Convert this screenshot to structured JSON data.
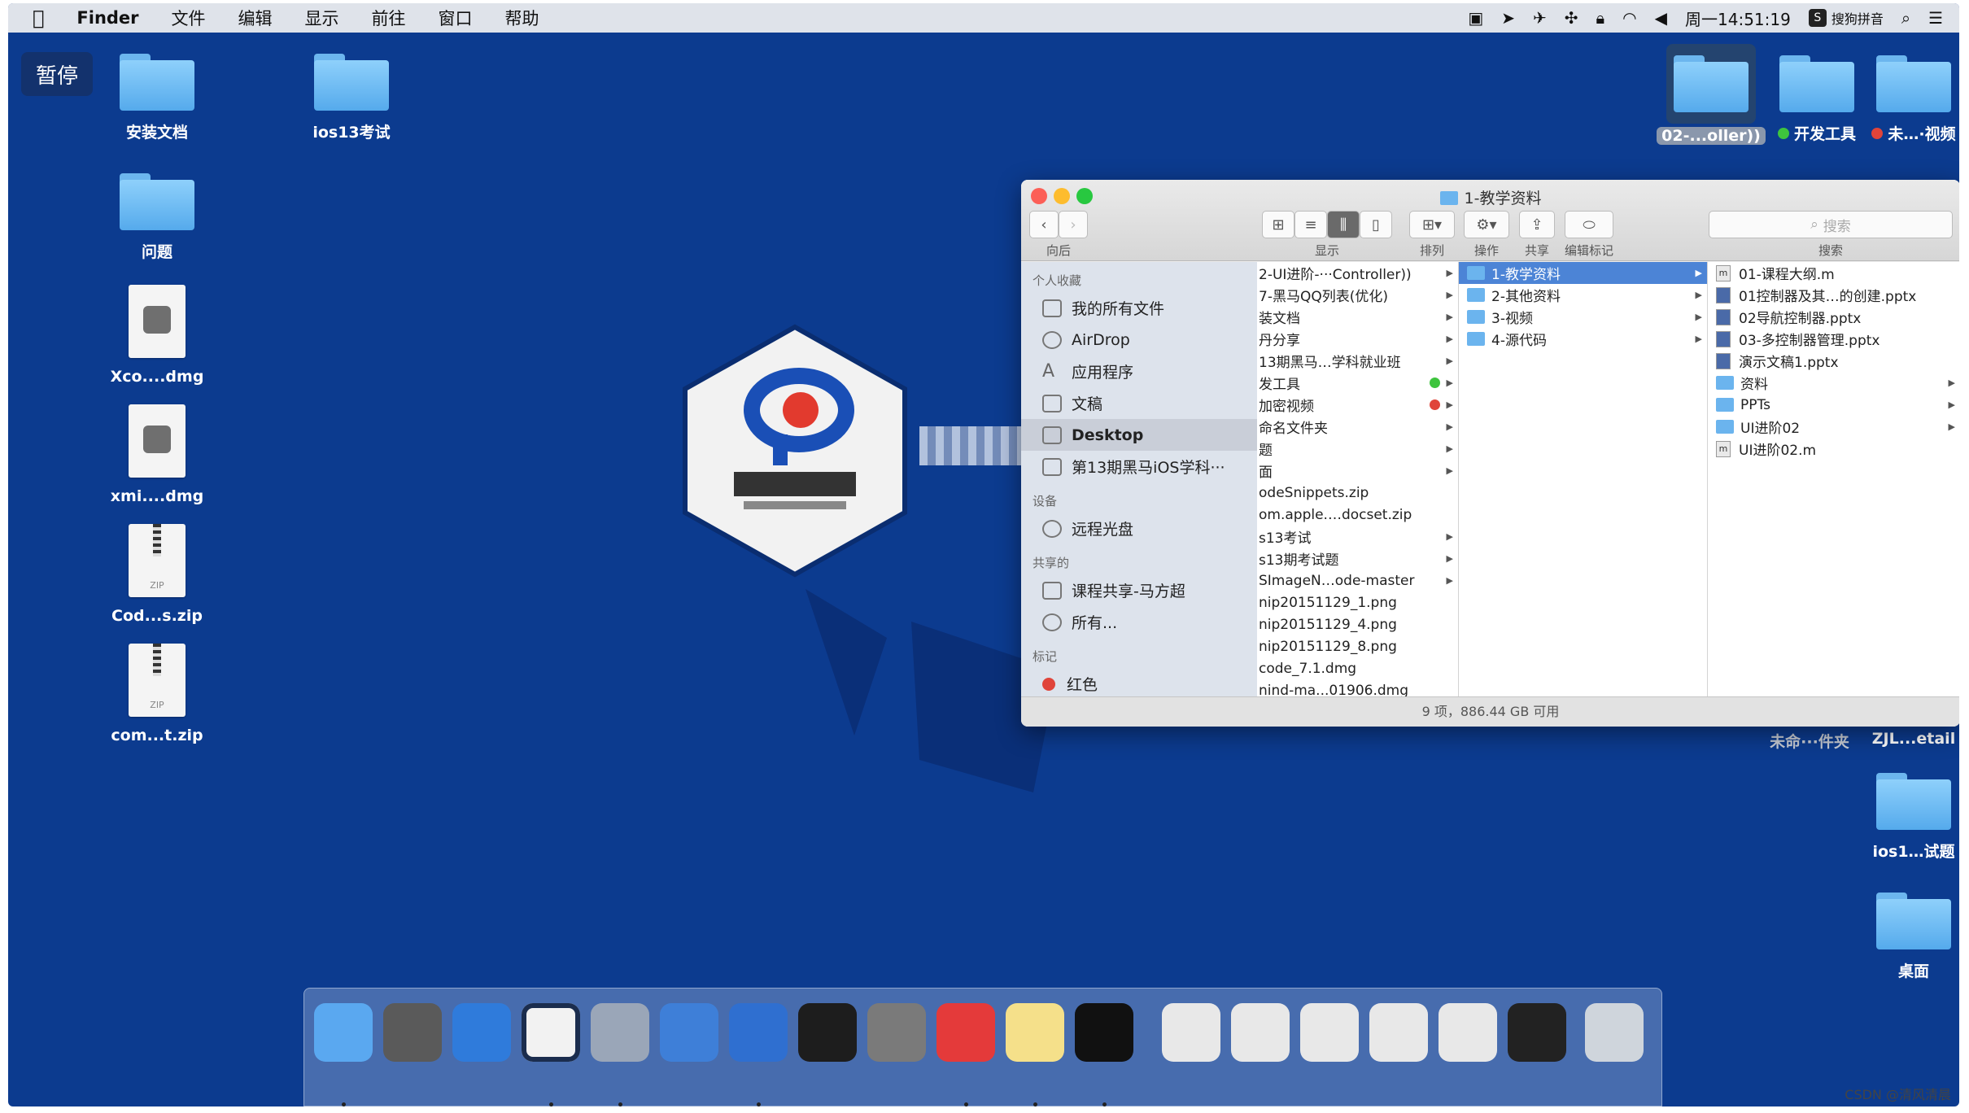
{
  "menubar": {
    "apple": "",
    "app": "Finder",
    "items": [
      "文件",
      "编辑",
      "显示",
      "前往",
      "窗口",
      "帮助"
    ],
    "clock": "周一14:51:19",
    "ime": "搜狗拼音"
  },
  "desktop": {
    "pause_label": "暂停",
    "left_icons": [
      {
        "label": "安装文档",
        "type": "folder"
      },
      {
        "label": "ios13考试",
        "type": "folder"
      },
      {
        "label": "问题",
        "type": "folder"
      },
      {
        "label": "Xco....dmg",
        "type": "dmg"
      },
      {
        "label": "xmi....dmg",
        "type": "dmg"
      },
      {
        "label": "Cod...s.zip",
        "type": "zip"
      },
      {
        "label": "com...t.zip",
        "type": "zip"
      }
    ],
    "right_icons": [
      {
        "label": "02-...oller))",
        "type": "folder"
      },
      {
        "label": "开发工具",
        "type": "folder",
        "tag": "#3ec43e"
      },
      {
        "label": "未…·视频",
        "type": "folder",
        "tag": "#e0443a"
      },
      {
        "label": "未命···件夹",
        "type": "folder"
      },
      {
        "label": "ZJL...etail",
        "type": "folder"
      },
      {
        "label": "ios1…试题",
        "type": "folder"
      },
      {
        "label": "桌面",
        "type": "folder"
      }
    ],
    "zip_text": "ZIP"
  },
  "finder": {
    "title": "1-教学资料",
    "toolbar": {
      "back_label": "向后",
      "view_label": "显示",
      "arrange_label": "排列",
      "action_label": "操作",
      "share_label": "共享",
      "tags_label": "编辑标记",
      "search_label": "搜索",
      "search_placeholder": "搜索"
    },
    "sidebar": {
      "favorites_header": "个人收藏",
      "favorites": [
        "我的所有文件",
        "AirDrop",
        "应用程序",
        "文稿",
        "Desktop",
        "第13期黑马iOS学科···"
      ],
      "devices_header": "设备",
      "devices": [
        "远程光盘"
      ],
      "shared_header": "共享的",
      "shared": [
        "课程共享-马方超",
        "所有..."
      ],
      "tags_header": "标记",
      "tags": [
        "红色"
      ]
    },
    "col1": [
      {
        "name": "2-UI进阶-···Controller))",
        "arrow": true
      },
      {
        "name": "7-黑马QQ列表(优化)",
        "arrow": true
      },
      {
        "name": "装文档",
        "arrow": true
      },
      {
        "name": "丹分享",
        "arrow": true
      },
      {
        "name": "13期黑马…学科就业班",
        "arrow": true
      },
      {
        "name": "发工具",
        "arrow": true,
        "tag": "#3ec43e"
      },
      {
        "name": "加密视频",
        "arrow": true,
        "tag": "#e0443a"
      },
      {
        "name": "命名文件夹",
        "arrow": true
      },
      {
        "name": "题",
        "arrow": true
      },
      {
        "name": "面",
        "arrow": true
      },
      {
        "name": "odeSnippets.zip",
        "arrow": false
      },
      {
        "name": "om.apple.…docset.zip",
        "arrow": false
      },
      {
        "name": "s13考试",
        "arrow": true
      },
      {
        "name": "s13期考试题",
        "arrow": true
      },
      {
        "name": "SImageN…ode-master",
        "arrow": true
      },
      {
        "name": "nip20151129_1.png",
        "arrow": false
      },
      {
        "name": "nip20151129_4.png",
        "arrow": false
      },
      {
        "name": "nip20151129_8.png",
        "arrow": false
      },
      {
        "name": "code_7.1.dmg",
        "arrow": false
      },
      {
        "name": "nind-ma...01906.dmg",
        "arrow": false
      }
    ],
    "col2": [
      {
        "name": "1-教学资料",
        "arrow": true,
        "selected": true
      },
      {
        "name": "2-其他资料",
        "arrow": true
      },
      {
        "name": "3-视频",
        "arrow": true
      },
      {
        "name": "4-源代码",
        "arrow": true
      }
    ],
    "col3": [
      {
        "name": "01-课程大纲.m",
        "kind": "m",
        "arrow": false
      },
      {
        "name": "01控制器及其…的创建.pptx",
        "kind": "ppt",
        "arrow": false
      },
      {
        "name": "02导航控制器.pptx",
        "kind": "ppt",
        "arrow": false
      },
      {
        "name": "03-多控制器管理.pptx",
        "kind": "ppt",
        "arrow": false
      },
      {
        "name": "演示文稿1.pptx",
        "kind": "ppt",
        "arrow": false
      },
      {
        "name": "资料",
        "kind": "folder",
        "arrow": true
      },
      {
        "name": "PPTs",
        "kind": "folder",
        "arrow": true
      },
      {
        "name": "UI进阶02",
        "kind": "folder",
        "arrow": true
      },
      {
        "name": "UI进阶02.m",
        "kind": "m",
        "arrow": false
      }
    ],
    "m_glyph": "m",
    "status": "9 项，886.44 GB 可用"
  },
  "dock": {
    "apps": [
      "finder-icon",
      "launchpad-icon",
      "safari-icon",
      "mouse-icon",
      "photo-slideshow-icon",
      "xcode-icon",
      "instruments-icon",
      "terminal-icon",
      "system-preferences-icon",
      "xmind-icon",
      "notes-icon",
      "console-icon",
      "doc1-icon",
      "doc2-icon",
      "doc3-icon",
      "doc4-icon",
      "doc5-icon",
      "calculator-icon",
      "trash-icon"
    ]
  },
  "watermark": "CSDN @清风清晨"
}
